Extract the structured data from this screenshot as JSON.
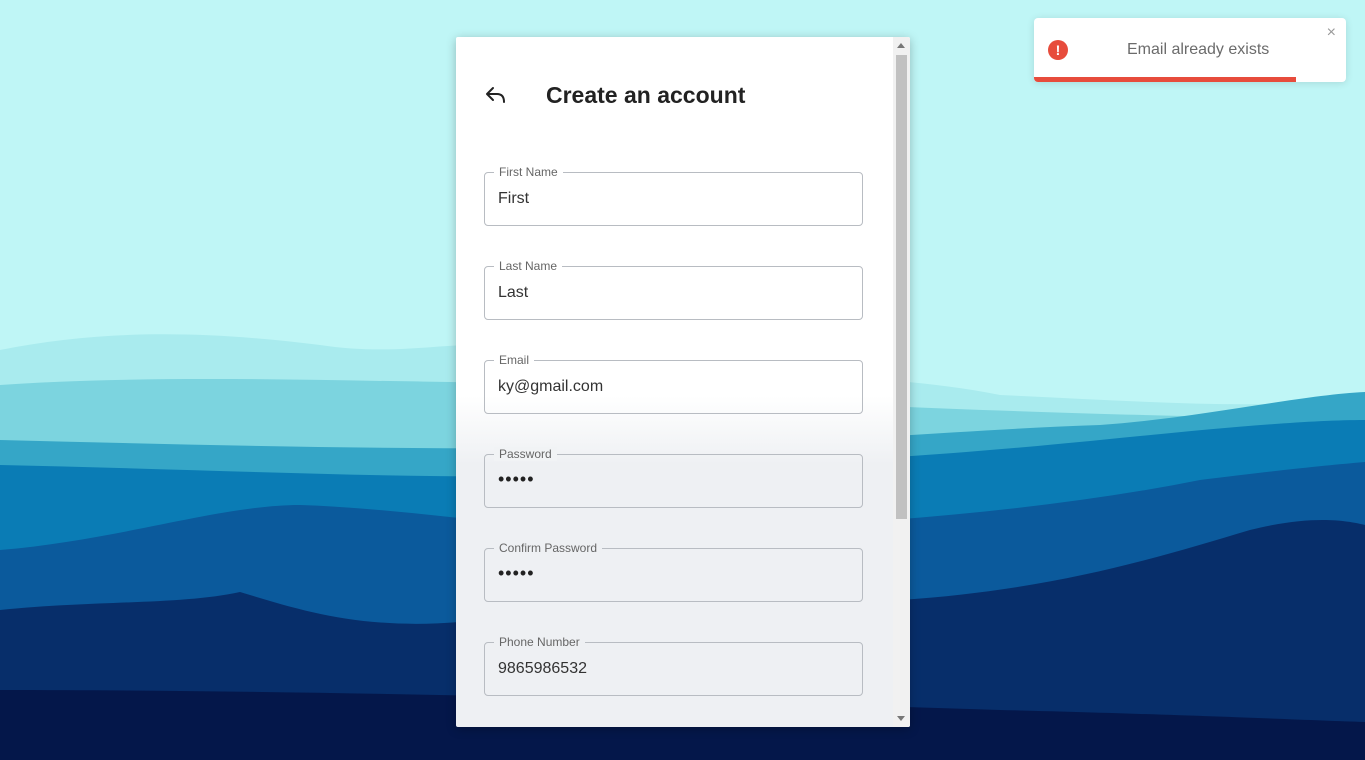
{
  "form": {
    "title": "Create an account",
    "back_icon": "reply-arrow-icon",
    "fields": [
      {
        "label": "First Name",
        "value": "First"
      },
      {
        "label": "Last Name",
        "value": "Last"
      },
      {
        "label": "Email",
        "value": "ky@gmail.com"
      },
      {
        "label": "Password",
        "value": "•••••"
      },
      {
        "label": "Confirm Password",
        "value": "•••••"
      },
      {
        "label": "Phone Number",
        "value": "9865986532"
      }
    ]
  },
  "toast": {
    "message": "Email already exists",
    "icon": "error-circle-icon",
    "close_symbol": "×",
    "progress": 0.84,
    "color": "#e74c3c"
  },
  "colors": {
    "sky": "#bff6f6",
    "accent_error": "#e74c3c"
  }
}
